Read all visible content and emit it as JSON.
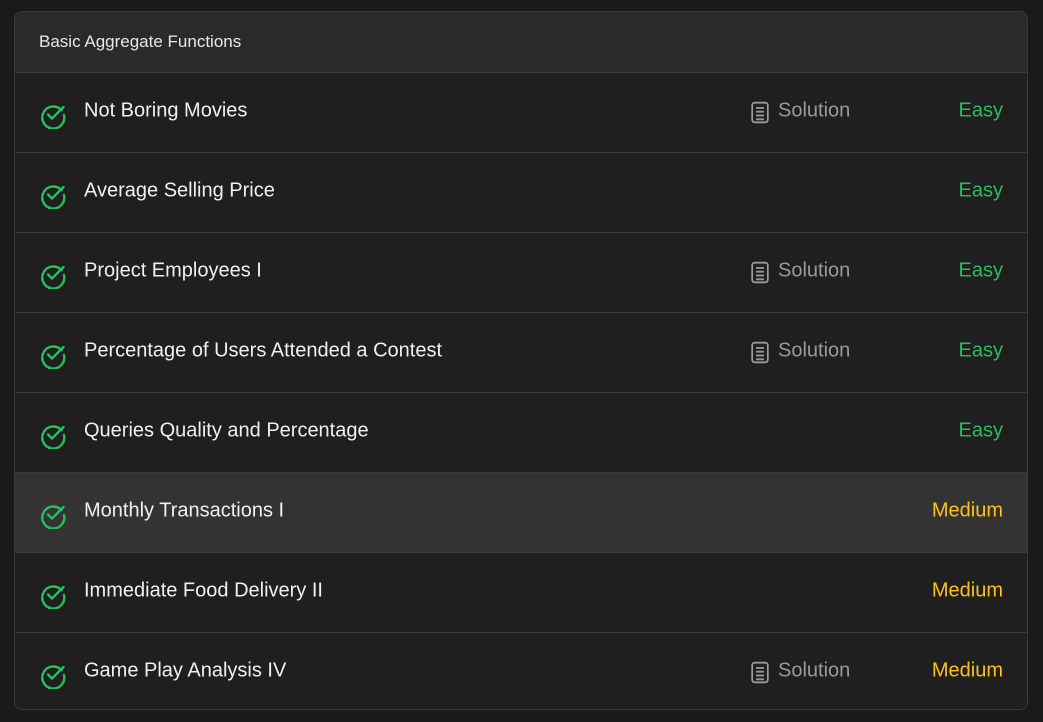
{
  "section": {
    "title": "Basic Aggregate Functions"
  },
  "colors": {
    "easy": "#2cbb5d",
    "medium": "#ffc01e",
    "check": "#2cbb5d"
  },
  "problems": [
    {
      "title": "Not Boring Movies",
      "solution_label": "Solution",
      "has_solution": true,
      "difficulty": "Easy",
      "status_icon": "check-circle-icon"
    },
    {
      "title": "Average Selling Price",
      "solution_label": "",
      "has_solution": false,
      "difficulty": "Easy",
      "status_icon": "check-circle-icon"
    },
    {
      "title": "Project Employees I",
      "solution_label": "Solution",
      "has_solution": true,
      "difficulty": "Easy",
      "status_icon": "check-circle-icon"
    },
    {
      "title": "Percentage of Users Attended a Contest",
      "solution_label": "Solution",
      "has_solution": true,
      "difficulty": "Easy",
      "status_icon": "check-circle-icon"
    },
    {
      "title": "Queries Quality and Percentage",
      "solution_label": "",
      "has_solution": false,
      "difficulty": "Easy",
      "status_icon": "check-circle-icon"
    },
    {
      "title": "Monthly Transactions I",
      "solution_label": "",
      "has_solution": false,
      "difficulty": "Medium",
      "status_icon": "check-circle-icon",
      "hovered": true
    },
    {
      "title": "Immediate Food Delivery II",
      "solution_label": "",
      "has_solution": false,
      "difficulty": "Medium",
      "status_icon": "check-circle-icon"
    },
    {
      "title": "Game Play Analysis IV",
      "solution_label": "Solution",
      "has_solution": true,
      "difficulty": "Medium",
      "status_icon": "check-circle-icon"
    }
  ]
}
